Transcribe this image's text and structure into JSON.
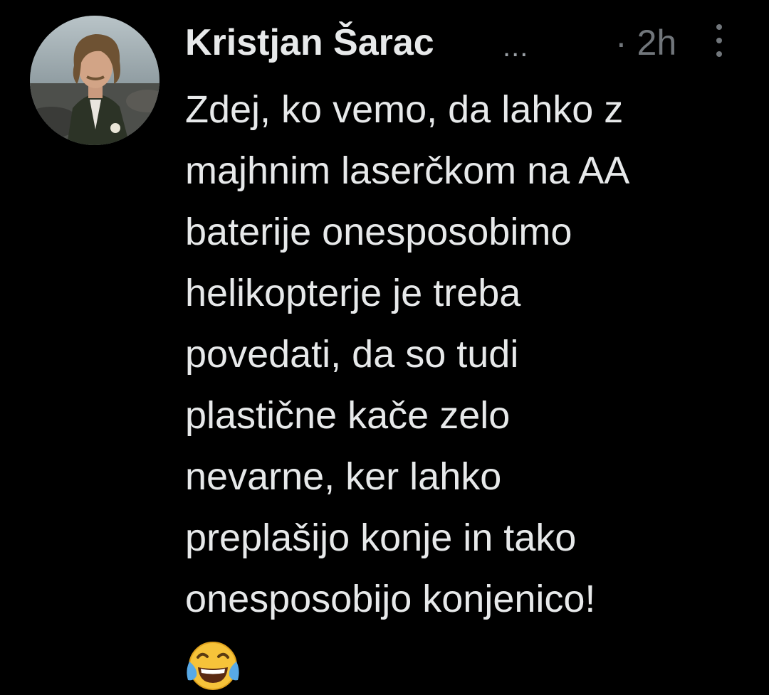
{
  "tweet": {
    "author_name": "Kristjan Šarac",
    "name_ellipsis": "...",
    "timestamp": "· 2h",
    "lines": [
      "Zdej, ko vemo, da lahko z",
      "majhnim laserčkom na AA",
      "baterije onesposobimo",
      "helikopterje je treba",
      "povedati, da so tudi",
      "plastične kače zelo",
      "nevarne, ker lahko",
      "preplašijo konje in tako",
      "onesposobijo konjenico!"
    ],
    "emoji": "face-with-tears-of-joy-icon"
  },
  "colors": {
    "background": "#000000",
    "text": "#e7e9ea",
    "secondary": "#71767b"
  }
}
